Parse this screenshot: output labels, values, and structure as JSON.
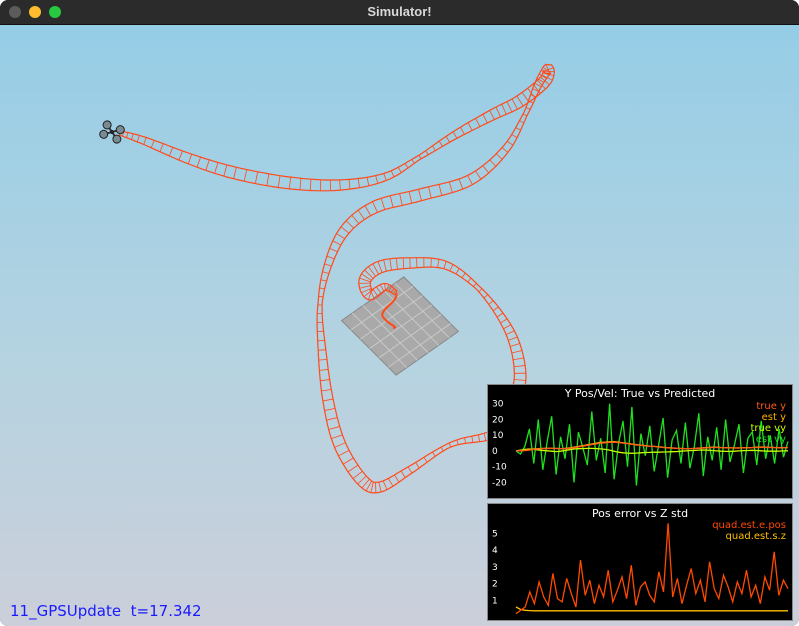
{
  "window": {
    "title": "Simulator!"
  },
  "status": {
    "scenario": "11_GPSUpdate",
    "time": "t=17.342"
  },
  "colors": {
    "trajectory": "#ff4a1a",
    "true_y": "#ff5a1a",
    "est_y": "#ffb000",
    "true_vy": "#c8ff00",
    "est_vy": "#20e020",
    "pos_err": "#ff4a00",
    "est_s_z": "#ffc000"
  },
  "icons": {
    "vehicle": "quadrotor-icon",
    "ground": "landing-pad-grid"
  },
  "plots": {
    "y_pos_vel": {
      "chart_data": {
        "type": "line",
        "title": "Y Pos/Vel: True vs Predicted",
        "ylim": [
          -28,
          33
        ],
        "yticks": [
          30,
          20,
          10,
          0,
          -10,
          -20
        ],
        "series": [
          {
            "name": "true y",
            "color": "#ff5a1a",
            "values": [
              0,
              0,
              0.2,
              0.5,
              1,
              1.2,
              1.4,
              1.5,
              1.6,
              1.5,
              1.4,
              1.4,
              1.6,
              2,
              2.5,
              3,
              3.5,
              4,
              4.5,
              5,
              5.2,
              5.4,
              5.5,
              5.3,
              5,
              4.6,
              4.2,
              3.8,
              3.5,
              3.2,
              3,
              2.8,
              2.5,
              2.2,
              2,
              1.8,
              1.6,
              1.5,
              1.4,
              1.4,
              1.5,
              1.6,
              1.8,
              2,
              2.2,
              2.2,
              2.1,
              2,
              1.9,
              1.8,
              1.8,
              1.9,
              2,
              2.1,
              2.2,
              2.3,
              2.3,
              2.2,
              2.1,
              2,
              2,
              2.1
            ]
          },
          {
            "name": "est y",
            "color": "#ffb000",
            "values": [
              0,
              0.3,
              0.6,
              0.9,
              1.3,
              1.5,
              1.6,
              1.7,
              1.7,
              1.6,
              1.5,
              1.6,
              1.9,
              2.4,
              2.9,
              3.4,
              3.9,
              4.4,
              4.9,
              5.4,
              5.6,
              5.8,
              5.9,
              5.6,
              5.2,
              4.8,
              4.4,
              4,
              3.7,
              3.4,
              3.1,
              2.9,
              2.6,
              2.3,
              2.1,
              1.9,
              1.7,
              1.6,
              1.5,
              1.5,
              1.6,
              1.8,
              2,
              2.2,
              2.4,
              2.4,
              2.2,
              2.1,
              2,
              1.9,
              1.9,
              2,
              2.1,
              2.2,
              2.4,
              2.5,
              2.4,
              2.3,
              2.2,
              2.1,
              2.1,
              2.2
            ]
          },
          {
            "name": "true vy",
            "color": "#c8ff00",
            "values": [
              0,
              0.5,
              1,
              1.2,
              1,
              0.6,
              0.3,
              0.1,
              -0.2,
              -0.4,
              -0.2,
              0.3,
              0.8,
              1.2,
              1.4,
              1.5,
              1.6,
              1.6,
              1.5,
              1.3,
              1,
              0.5,
              -0.2,
              -0.8,
              -1.2,
              -1.4,
              -1.5,
              -1.4,
              -1.2,
              -1,
              -0.9,
              -0.8,
              -0.8,
              -0.7,
              -0.6,
              -0.5,
              -0.4,
              -0.2,
              0,
              0.2,
              0.3,
              0.5,
              0.6,
              0.5,
              0.3,
              0,
              -0.2,
              -0.3,
              -0.3,
              -0.2,
              0,
              0.2,
              0.3,
              0.4,
              0.3,
              0.1,
              -0.1,
              -0.2,
              -0.2,
              -0.1,
              0,
              0.1
            ]
          },
          {
            "name": "est vy",
            "color": "#20e020",
            "values": [
              0,
              -2,
              3,
              14,
              -8,
              20,
              -12,
              6,
              22,
              -15,
              9,
              -5,
              17,
              -20,
              12,
              2,
              -9,
              25,
              -6,
              8,
              -14,
              30,
              -18,
              5,
              19,
              -10,
              28,
              -22,
              11,
              -3,
              16,
              -13,
              4,
              21,
              -17,
              7,
              13,
              -8,
              18,
              -11,
              3,
              24,
              -16,
              9,
              -6,
              15,
              -12,
              20,
              -7,
              4,
              17,
              -14,
              8,
              12,
              -9,
              19,
              -5,
              10,
              -8,
              14,
              -4,
              6
            ]
          }
        ]
      }
    },
    "pos_err_z_std": {
      "chart_data": {
        "type": "line",
        "title": "Pos error vs Z std",
        "ylim": [
          0,
          5.8
        ],
        "yticks": [
          5,
          4,
          3,
          2,
          1
        ],
        "series": [
          {
            "name": "quad.est.e.pos",
            "color": "#ff4a00",
            "values": [
              0.2,
              0.4,
              0.6,
              1.5,
              0.8,
              2.1,
              1.2,
              0.7,
              2.6,
              1.1,
              0.9,
              2.3,
              1.4,
              0.6,
              3.4,
              1.3,
              2.2,
              0.8,
              1.9,
              1.2,
              2.8,
              0.9,
              1.6,
              2.4,
              1.1,
              3.1,
              0.7,
              1.8,
              2.1,
              1.3,
              0.9,
              2.7,
              1.5,
              5.6,
              1.2,
              2.3,
              0.8,
              1.9,
              2.9,
              1.4,
              2.2,
              0.9,
              3.3,
              1.7,
              1.1,
              2.5,
              1.8,
              0.9,
              2.1,
              1.4,
              2.8,
              1.2,
              1.9,
              0.8,
              2.4,
              1.6,
              3.9,
              1.3,
              2.2,
              1.7
            ]
          },
          {
            "name": "quad.est.s.z",
            "color": "#ffc000",
            "values": [
              0.6,
              0.45,
              0.4,
              0.38,
              0.37,
              0.37,
              0.37,
              0.37,
              0.37,
              0.37,
              0.37,
              0.37,
              0.37,
              0.37,
              0.37,
              0.37,
              0.37,
              0.37,
              0.37,
              0.37,
              0.37,
              0.37,
              0.37,
              0.37,
              0.37,
              0.37,
              0.37,
              0.37,
              0.37,
              0.37,
              0.37,
              0.37,
              0.37,
              0.37,
              0.37,
              0.37,
              0.37,
              0.37,
              0.37,
              0.37,
              0.37,
              0.37,
              0.37,
              0.37,
              0.37,
              0.37,
              0.37,
              0.37,
              0.37,
              0.37,
              0.37,
              0.37,
              0.37,
              0.37,
              0.37,
              0.37,
              0.37,
              0.37,
              0.37,
              0.37
            ]
          }
        ]
      }
    }
  }
}
